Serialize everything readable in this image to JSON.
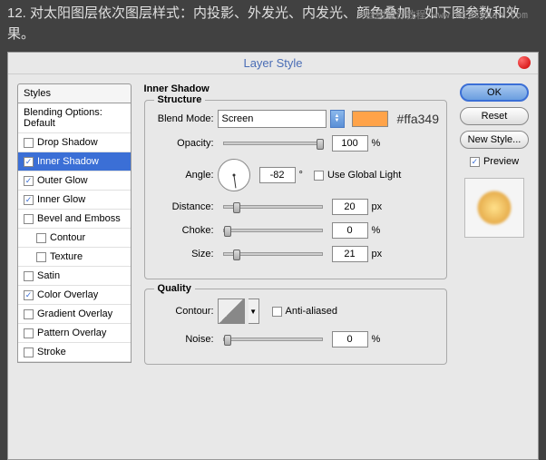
{
  "header": "12. 对太阳图层依次图层样式：内投影、外发光、内发光、颜色叠加，如下图参数和效果。",
  "watermark": "丝缕设计教程 www.missyuan.com",
  "dialog": {
    "title": "Layer Style"
  },
  "styles": {
    "header": "Styles",
    "items": [
      {
        "label": "Blending Options: Default",
        "checked": null
      },
      {
        "label": "Drop Shadow",
        "checked": false
      },
      {
        "label": "Inner Shadow",
        "checked": true,
        "selected": true
      },
      {
        "label": "Outer Glow",
        "checked": true
      },
      {
        "label": "Inner Glow",
        "checked": true
      },
      {
        "label": "Bevel and Emboss",
        "checked": false
      },
      {
        "label": "Contour",
        "checked": false,
        "indent": true
      },
      {
        "label": "Texture",
        "checked": false,
        "indent": true
      },
      {
        "label": "Satin",
        "checked": false
      },
      {
        "label": "Color Overlay",
        "checked": true
      },
      {
        "label": "Gradient Overlay",
        "checked": false
      },
      {
        "label": "Pattern Overlay",
        "checked": false
      },
      {
        "label": "Stroke",
        "checked": false
      }
    ]
  },
  "inner_shadow": {
    "title": "Inner Shadow",
    "structure": {
      "legend": "Structure",
      "blend_mode_label": "Blend Mode:",
      "blend_mode": "Screen",
      "color": "#ffa349",
      "color_hex": "#ffa349",
      "opacity_label": "Opacity:",
      "opacity": "100",
      "opacity_unit": "%",
      "angle_label": "Angle:",
      "angle": "-82",
      "angle_unit": "°",
      "use_global_label": "Use Global Light",
      "use_global": false,
      "distance_label": "Distance:",
      "distance": "20",
      "distance_unit": "px",
      "choke_label": "Choke:",
      "choke": "0",
      "choke_unit": "%",
      "size_label": "Size:",
      "size": "21",
      "size_unit": "px"
    },
    "quality": {
      "legend": "Quality",
      "contour_label": "Contour:",
      "anti_aliased_label": "Anti-aliased",
      "anti_aliased": false,
      "noise_label": "Noise:",
      "noise": "0",
      "noise_unit": "%"
    }
  },
  "buttons": {
    "ok": "OK",
    "reset": "Reset",
    "new_style": "New Style...",
    "preview": "Preview"
  }
}
